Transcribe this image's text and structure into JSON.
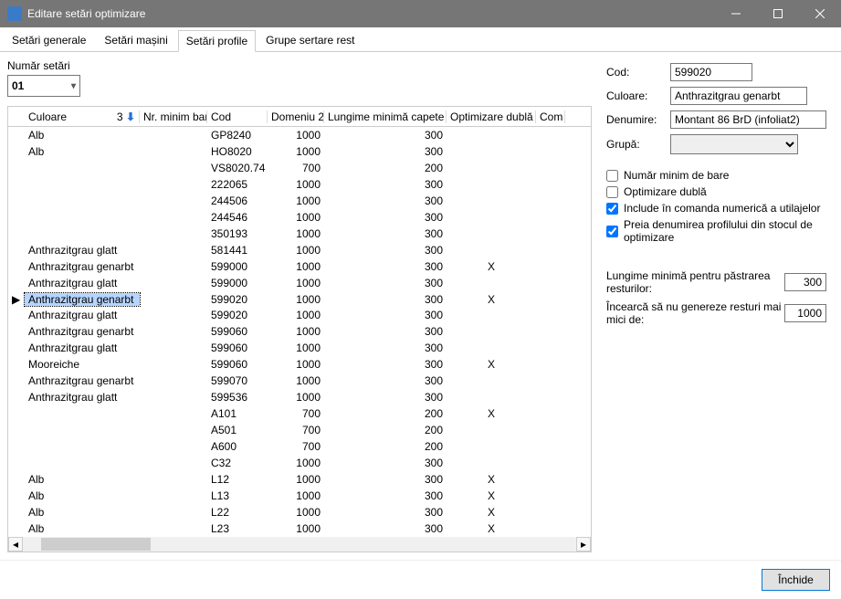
{
  "title": "Editare setări optimizare",
  "tabs": {
    "t0": "Setări generale",
    "t1": "Setări mașini",
    "t2": "Setări profile",
    "t3": "Grupe sertare rest"
  },
  "numar_setari_label": "Număr setări",
  "numar_setari_value": "01",
  "grid": {
    "headers": {
      "culoare": "Culoare",
      "culoare_sort": "3",
      "nr_min": "Nr. minim bare",
      "cod": "Cod",
      "dom2": "Domeniu 2",
      "lung": "Lungime minimă capete",
      "opt": "Optimizare dublă",
      "com": "Com"
    },
    "rows": [
      {
        "culoare": "Alb",
        "cod": "GP8240",
        "dom": "1000",
        "lung": "300",
        "opt": "",
        "sel": 0
      },
      {
        "culoare": "Alb",
        "cod": "HO8020",
        "dom": "1000",
        "lung": "300",
        "opt": "",
        "sel": 0
      },
      {
        "culoare": "",
        "cod": "VS8020.74",
        "dom": "700",
        "lung": "200",
        "opt": "",
        "sel": 0
      },
      {
        "culoare": "",
        "cod": "222065",
        "dom": "1000",
        "lung": "300",
        "opt": "",
        "sel": 0
      },
      {
        "culoare": "",
        "cod": "244506",
        "dom": "1000",
        "lung": "300",
        "opt": "",
        "sel": 0
      },
      {
        "culoare": "",
        "cod": "244546",
        "dom": "1000",
        "lung": "300",
        "opt": "",
        "sel": 0
      },
      {
        "culoare": "",
        "cod": "350193",
        "dom": "1000",
        "lung": "300",
        "opt": "",
        "sel": 0
      },
      {
        "culoare": "Anthrazitgrau glatt",
        "cod": "581441",
        "dom": "1000",
        "lung": "300",
        "opt": "",
        "sel": 0
      },
      {
        "culoare": "Anthrazitgrau genarbt",
        "cod": "599000",
        "dom": "1000",
        "lung": "300",
        "opt": "X",
        "sel": 0
      },
      {
        "culoare": "Anthrazitgrau glatt",
        "cod": "599000",
        "dom": "1000",
        "lung": "300",
        "opt": "",
        "sel": 0
      },
      {
        "culoare": "Anthrazitgrau genarbt",
        "cod": "599020",
        "dom": "1000",
        "lung": "300",
        "opt": "X",
        "sel": 1
      },
      {
        "culoare": "Anthrazitgrau glatt",
        "cod": "599020",
        "dom": "1000",
        "lung": "300",
        "opt": "",
        "sel": 0
      },
      {
        "culoare": "Anthrazitgrau genarbt",
        "cod": "599060",
        "dom": "1000",
        "lung": "300",
        "opt": "",
        "sel": 0
      },
      {
        "culoare": "Anthrazitgrau glatt",
        "cod": "599060",
        "dom": "1000",
        "lung": "300",
        "opt": "",
        "sel": 0
      },
      {
        "culoare": "Mooreiche",
        "cod": "599060",
        "dom": "1000",
        "lung": "300",
        "opt": "X",
        "sel": 0
      },
      {
        "culoare": "Anthrazitgrau genarbt",
        "cod": "599070",
        "dom": "1000",
        "lung": "300",
        "opt": "",
        "sel": 0
      },
      {
        "culoare": "Anthrazitgrau glatt",
        "cod": "599536",
        "dom": "1000",
        "lung": "300",
        "opt": "",
        "sel": 0
      },
      {
        "culoare": "",
        "cod": "A101",
        "dom": "700",
        "lung": "200",
        "opt": "X",
        "sel": 0
      },
      {
        "culoare": "",
        "cod": "A501",
        "dom": "700",
        "lung": "200",
        "opt": "",
        "sel": 0
      },
      {
        "culoare": "",
        "cod": "A600",
        "dom": "700",
        "lung": "200",
        "opt": "",
        "sel": 0
      },
      {
        "culoare": "",
        "cod": "C32",
        "dom": "1000",
        "lung": "300",
        "opt": "",
        "sel": 0
      },
      {
        "culoare": "Alb",
        "cod": "L12",
        "dom": "1000",
        "lung": "300",
        "opt": "X",
        "sel": 0
      },
      {
        "culoare": "Alb",
        "cod": "L13",
        "dom": "1000",
        "lung": "300",
        "opt": "X",
        "sel": 0
      },
      {
        "culoare": "Alb",
        "cod": "L22",
        "dom": "1000",
        "lung": "300",
        "opt": "X",
        "sel": 0
      },
      {
        "culoare": "Alb",
        "cod": "L23",
        "dom": "1000",
        "lung": "300",
        "opt": "X",
        "sel": 0
      }
    ]
  },
  "right": {
    "cod_label": "Cod:",
    "cod_value": "599020",
    "culoare_label": "Culoare:",
    "culoare_value": "Anthrazitgrau genarbt",
    "denumire_label": "Denumire:",
    "denumire_value": "Montant 86 BrD (infoliat2)",
    "grupa_label": "Grupă:",
    "grupa_value": "",
    "chk1": "Număr minim de bare",
    "chk2": "Optimizare dublă",
    "chk3": "Include în comanda numerică a utilajelor",
    "chk4": "Preia denumirea profilului din stocul de optimizare",
    "lng_label": "Lungime minimă pentru păstrarea resturilor:",
    "lng_value": "300",
    "rest_label": "Încearcă să nu genereze resturi mai mici de:",
    "rest_value": "1000"
  },
  "close_label": "Închide"
}
